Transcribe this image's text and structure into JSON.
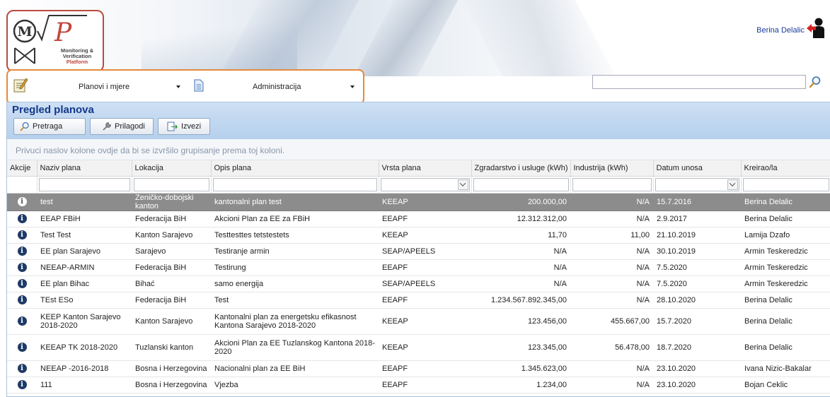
{
  "logo": {
    "subtitle_line1": "Monitoring &",
    "subtitle_line2": "Verification",
    "subtitle_line3": "Platform"
  },
  "user": {
    "name": "Berina Delalic"
  },
  "nav": {
    "menu1_label": "Planovi i mjere",
    "menu2_label": "Administracija"
  },
  "search": {
    "value": "",
    "placeholder": ""
  },
  "panel": {
    "title": "Pregled planova",
    "buttons": {
      "search": "Pretraga",
      "customize": "Prilagodi",
      "export": "Izvezi"
    },
    "group_hint": "Privuci naslov kolone ovdje da bi se izvršilo grupisanje prema toj koloni."
  },
  "table": {
    "columns": [
      "Akcije",
      "Naziv plana",
      "Lokacija",
      "Opis plana",
      "Vrsta plana",
      "Zgradarstvo i usluge (kWh)",
      "Industrija (kWh)",
      "Datum unosa",
      "Kreirao/la"
    ],
    "rows": [
      [
        "test",
        "Zeničko-dobojski kanton",
        "kantonalni plan test",
        "KEEAP",
        "200.000,00",
        "N/A",
        "15.7.2016",
        "Berina Delalic"
      ],
      [
        "EEAP FBiH",
        "Federacija BiH",
        "Akcioni Plan za EE za FBiH",
        "EEAPF",
        "12.312.312,00",
        "N/A",
        "2.9.2017",
        "Berina Delalic"
      ],
      [
        "Test Test",
        "Kanton Sarajevo",
        "Testtesttes tetstestets",
        "KEEAP",
        "11,70",
        "11,00",
        "21.10.2019",
        "Lamija Dzafo"
      ],
      [
        "EE plan Sarajevo",
        "Sarajevo",
        "Testiranje armin",
        "SEAP/APEELS",
        "N/A",
        "N/A",
        "30.10.2019",
        "Armin Teskeredzic"
      ],
      [
        "NEEAP-ARMIN",
        "Federacija BiH",
        "Testirung",
        "EEAPF",
        "N/A",
        "N/A",
        "7.5.2020",
        "Armin Teskeredzic"
      ],
      [
        "EE plan Bihac",
        "Bihać",
        "samo energija",
        "SEAP/APEELS",
        "N/A",
        "N/A",
        "7.5.2020",
        "Armin Teskeredzic"
      ],
      [
        "TEst ESo",
        "Federacija BiH",
        "Test",
        "EEAPF",
        "1.234.567.892.345,00",
        "N/A",
        "28.10.2020",
        "Berina Delalic"
      ],
      [
        "KEEP Kanton Sarajevo 2018-2020",
        "Kanton Sarajevo",
        "Kantonalni plan za energetsku efikasnost Kantona Sarajevo 2018-2020",
        "KEEAP",
        "123.456,00",
        "455.667,00",
        "15.7.2020",
        "Berina Delalic"
      ],
      [
        "KEEAP TK 2018-2020",
        "Tuzlanski kanton",
        "Akcioni Plan za EE Tuzlanskog Kantona 2018-2020",
        "KEEAP",
        "123.345,00",
        "56.478,00",
        "18.7.2020",
        "Berina Delalic"
      ],
      [
        "NEEAP -2016-2018",
        "Bosna i Herzegovina",
        "Nacionalni plan za EE BiH",
        "EEAPF",
        "1.345.623,00",
        "N/A",
        "23.10.2020",
        "Ivana Nizic-Bakalar"
      ],
      [
        "111",
        "Bosna i Herzegovina",
        "Vjezba",
        "EEAPF",
        "1.234,00",
        "N/A",
        "23.10.2020",
        "Bojan Ceklic"
      ]
    ]
  },
  "colors": {
    "panel_title": "#15388a",
    "selected_row": "#8c8c8c",
    "logo_border": "#b94a3f",
    "nav_border": "#e58a3b"
  }
}
